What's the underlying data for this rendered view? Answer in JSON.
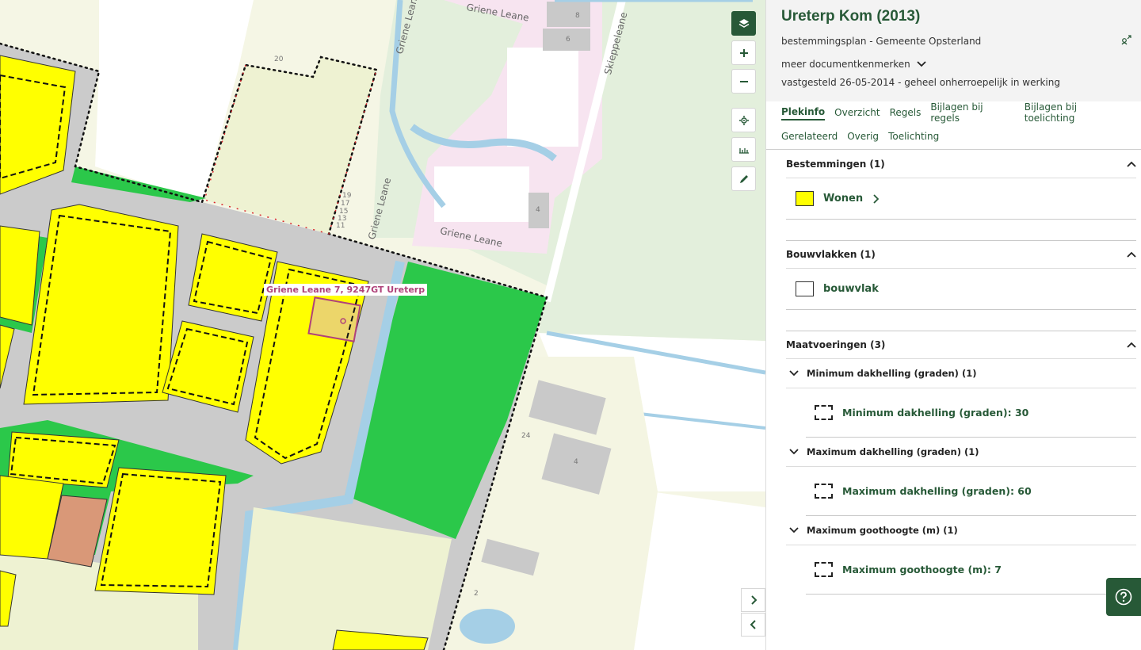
{
  "map": {
    "address_label": "Griene Leane 7, 9247GT Ureterp",
    "street_labels": [
      "Griene Leane",
      "Griene Leane",
      "Griene Leane",
      "Griene Leane",
      "Skieppeleane"
    ],
    "house_numbers": [
      "8",
      "6",
      "20",
      "19",
      "17",
      "15",
      "13",
      "11",
      "4",
      "24",
      "4",
      "2"
    ],
    "colors": {
      "wonen": "#ffff00",
      "groen": "#2bc84a",
      "bedrijf": "#d99878",
      "road": "#cbcbcb",
      "water": "#a5cfe6",
      "plan_boundary": "#111111",
      "red_hatch": "#d9262b",
      "green_accent": "#275937"
    },
    "tools": [
      "layers-icon",
      "zoom-in-icon",
      "zoom-out-icon",
      "locate-icon",
      "measure-icon",
      "draw-icon"
    ]
  },
  "panel": {
    "title": "Ureterp Kom (2013)",
    "subtitle": "bestemmingsplan - Gemeente Opsterland",
    "meta_toggle": "meer documentkenmerken",
    "status": "vastgesteld 26-05-2014 - geheel onherroepelijk in werking",
    "tabs": [
      {
        "label": "Plekinfo",
        "active": true
      },
      {
        "label": "Overzicht"
      },
      {
        "label": "Regels"
      },
      {
        "label": "Bijlagen bij regels"
      },
      {
        "label": "Bijlagen bij toelichting"
      },
      {
        "label": "Gerelateerd"
      },
      {
        "label": "Overig"
      },
      {
        "label": "Toelichting"
      }
    ],
    "sections": {
      "bestemmingen": {
        "title": "Bestemmingen (1)",
        "item": "Wonen"
      },
      "bouwvlakken": {
        "title": "Bouwvlakken (1)",
        "item": "bouwvlak"
      },
      "maatvoeringen": {
        "title": "Maatvoeringen (3)",
        "groups": [
          {
            "title": "Minimum dakhelling (graden) (1)",
            "item": "Minimum dakhelling (graden): 30"
          },
          {
            "title": "Maximum dakhelling (graden) (1)",
            "item": "Maximum dakhelling (graden): 60"
          },
          {
            "title": "Maximum goothoogte (m) (1)",
            "item": "Maximum goothoogte (m): 7"
          }
        ]
      }
    }
  }
}
